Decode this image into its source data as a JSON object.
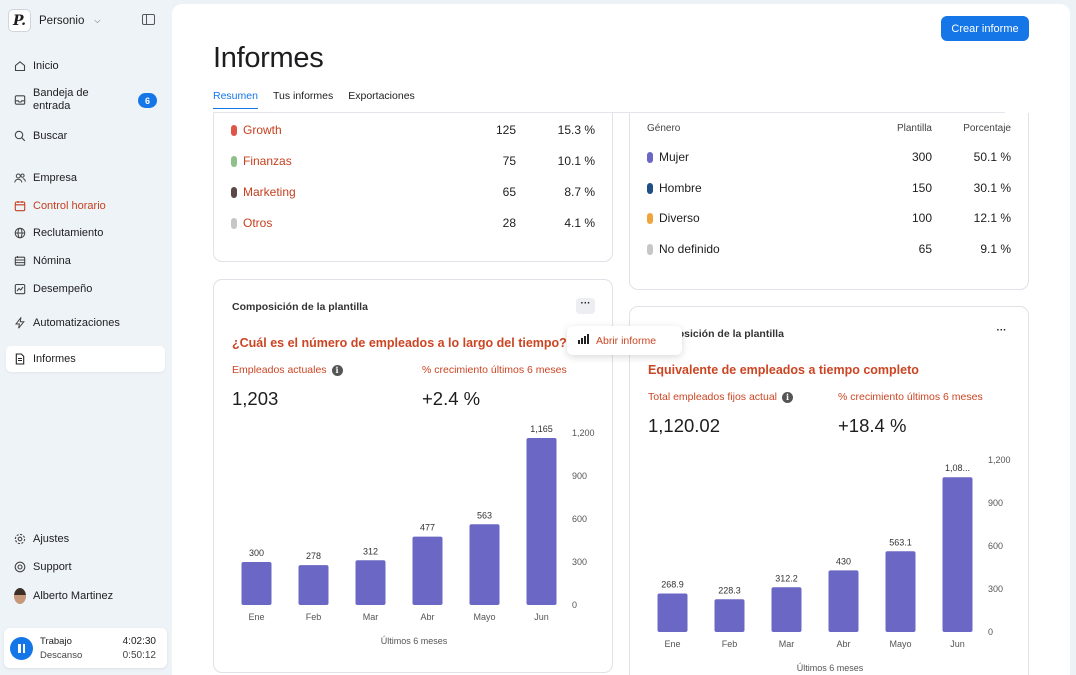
{
  "app": {
    "company": "Personio"
  },
  "sidebar": {
    "items": [
      {
        "label": "Inicio",
        "icon": "home-icon"
      },
      {
        "label": "Bandeja de entrada",
        "icon": "inbox-icon",
        "badge": "6"
      },
      {
        "label": "Buscar",
        "icon": "search-icon"
      },
      {
        "label": "Empresa",
        "icon": "people-icon"
      },
      {
        "label": "Control horario",
        "icon": "calendar-icon"
      },
      {
        "label": "Reclutamiento",
        "icon": "globe-icon"
      },
      {
        "label": "Nómina",
        "icon": "payroll-icon"
      },
      {
        "label": "Desempeño",
        "icon": "performance-icon"
      },
      {
        "label": "Automatizaciones",
        "icon": "lightning-icon"
      },
      {
        "label": "Informes",
        "icon": "document-icon"
      }
    ],
    "bottom": [
      {
        "label": "Ajustes",
        "icon": "gear-icon"
      },
      {
        "label": "Support",
        "icon": "support-icon"
      },
      {
        "label": "Alberto Martinez",
        "icon": "avatar"
      }
    ],
    "timer": {
      "work_label": "Trabajo",
      "work_time": "4:02:30",
      "break_label": "Descanso",
      "break_time": "0:50:12"
    }
  },
  "header": {
    "title": "Informes",
    "create_button": "Crear informe",
    "tabs": [
      "Resumen",
      "Tus informes",
      "Exportaciones"
    ],
    "active_tab": 0
  },
  "team_card": {
    "rows": [
      {
        "name": "Growth",
        "count": "125",
        "pct": "15.3 %",
        "color": "#e0554b"
      },
      {
        "name": "Finanzas",
        "count": "75",
        "pct": "10.1 %",
        "color": "#8dc08a"
      },
      {
        "name": "Marketing",
        "count": "65",
        "pct": "8.7 %",
        "color": "#5b4847"
      },
      {
        "name": "Otros",
        "count": "28",
        "pct": "4.1 %",
        "color": "#c6c6c6"
      }
    ]
  },
  "gender_card": {
    "col_gender": "Género",
    "col_headcount": "Plantilla",
    "col_pct": "Porcentaje",
    "rows": [
      {
        "name": "Mujer",
        "count": "300",
        "pct": "50.1 %",
        "color": "#6b67c4"
      },
      {
        "name": "Hombre",
        "count": "150",
        "pct": "30.1 %",
        "color": "#1f4f86"
      },
      {
        "name": "Diverso",
        "count": "100",
        "pct": "12.1 %",
        "color": "#f0a43a"
      },
      {
        "name": "No definido",
        "count": "65",
        "pct": "9.1 %",
        "color": "#c6c6c6"
      }
    ]
  },
  "headcount_card": {
    "title": "Composición de la plantilla",
    "question": "¿Cuál es el número de empleados a lo largo del tiempo?",
    "metric1_label": "Empleados actuales",
    "metric1_value": "1,203",
    "metric2_label": "% crecimiento últimos 6 meses",
    "metric2_value": "+2.4 %",
    "xlabel": "Últimos 6 meses",
    "popup_label": "Abrir informe"
  },
  "fte_card": {
    "title": "Composición de la plantilla",
    "question": "Equivalente de empleados a tiempo completo",
    "metric1_label": "Total empleados fijos actual",
    "metric1_value": "1,120.02",
    "metric2_label": "% crecimiento últimos 6 meses",
    "metric2_value": "+18.4 %",
    "xlabel": "Últimos 6 meses"
  },
  "chart_data": [
    {
      "type": "bar",
      "categories": [
        "Ene",
        "Feb",
        "Mar",
        "Abr",
        "Mayo",
        "Jun"
      ],
      "values": [
        300,
        278,
        312,
        477,
        563,
        1165
      ],
      "value_labels": [
        "300",
        "278",
        "312",
        "477",
        "563",
        "1,165"
      ],
      "yticks": [
        "0",
        "300",
        "600",
        "900",
        "1,200"
      ],
      "ylim": [
        0,
        1200
      ],
      "xlabel": "Últimos 6 meses",
      "color": "#6b67c4"
    },
    {
      "type": "bar",
      "categories": [
        "Ene",
        "Feb",
        "Mar",
        "Abr",
        "Mayo",
        "Jun"
      ],
      "values": [
        268.9,
        228.3,
        312.2,
        430,
        563.1,
        1080
      ],
      "value_labels": [
        "268.9",
        "228.3",
        "312.2",
        "430",
        "563.1",
        "1,08..."
      ],
      "yticks": [
        "0",
        "300",
        "600",
        "900",
        "1,200"
      ],
      "ylim": [
        0,
        1200
      ],
      "xlabel": "Últimos 6 meses",
      "color": "#6b67c4"
    }
  ]
}
